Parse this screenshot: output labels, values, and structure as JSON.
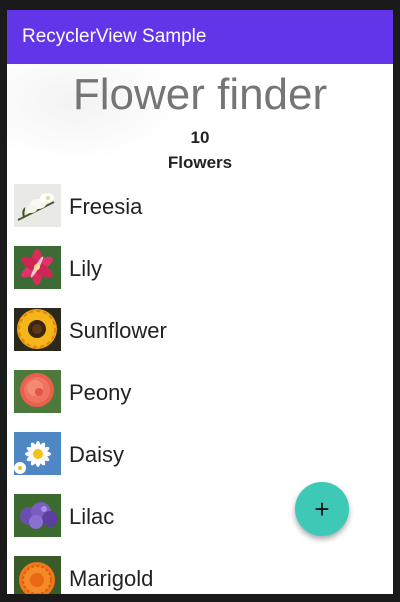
{
  "app_bar": {
    "title": "RecyclerView Sample"
  },
  "header": {
    "title": "Flower finder",
    "count": "10",
    "count_label": "Flowers"
  },
  "flowers": [
    {
      "name": "Freesia",
      "icon": "freesia-photo"
    },
    {
      "name": "Lily",
      "icon": "lily-photo"
    },
    {
      "name": "Sunflower",
      "icon": "sunflower-photo"
    },
    {
      "name": "Peony",
      "icon": "peony-photo"
    },
    {
      "name": "Daisy",
      "icon": "daisy-photo"
    },
    {
      "name": "Lilac",
      "icon": "lilac-photo"
    },
    {
      "name": "Marigold",
      "icon": "marigold-photo"
    }
  ],
  "fab": {
    "label": "+"
  },
  "colors": {
    "app_bar": "#6236e8",
    "fab": "#3ec9b6"
  }
}
